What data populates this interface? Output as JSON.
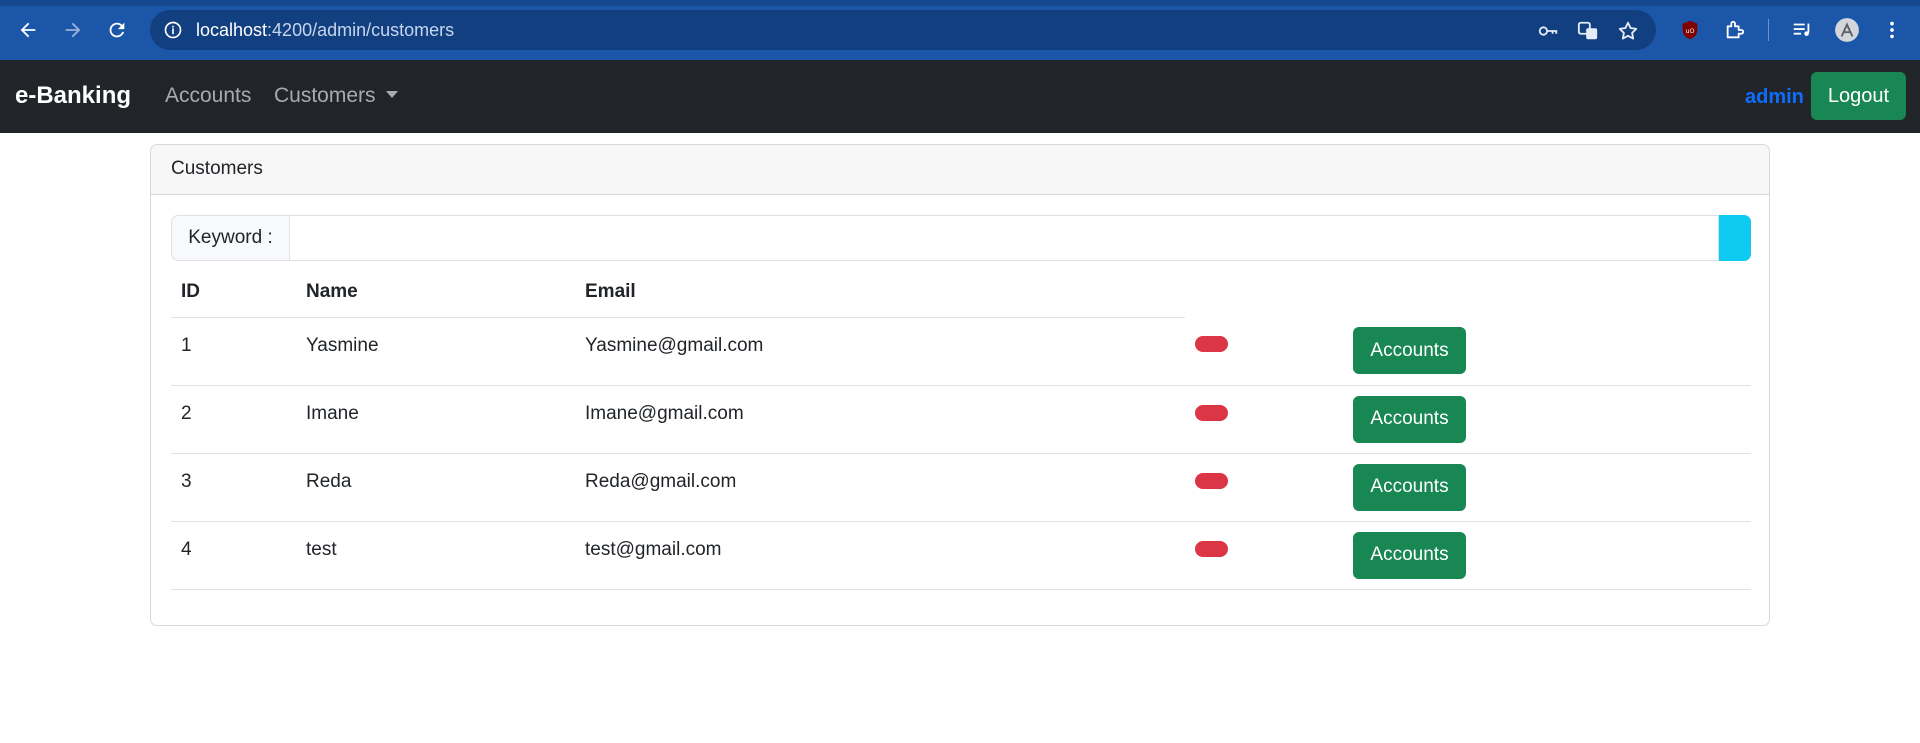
{
  "browser": {
    "url_host": "localhost",
    "url_path": ":4200/admin/customers"
  },
  "navbar": {
    "brand": "e-Banking",
    "links": [
      "Accounts",
      "Customers"
    ],
    "user": "admin",
    "logout_label": "Logout"
  },
  "card": {
    "title": "Customers",
    "search": {
      "label": "Keyword :",
      "value": "",
      "placeholder": ""
    },
    "table": {
      "headers": [
        "ID",
        "Name",
        "Email"
      ],
      "rows": [
        {
          "id": "1",
          "name": "Yasmine",
          "email": "Yasmine@gmail.com",
          "action_label": "Accounts"
        },
        {
          "id": "2",
          "name": "Imane",
          "email": "Imane@gmail.com",
          "action_label": "Accounts"
        },
        {
          "id": "3",
          "name": "Reda",
          "email": "Reda@gmail.com",
          "action_label": "Accounts"
        },
        {
          "id": "4",
          "name": "test",
          "email": "test@gmail.com",
          "action_label": "Accounts"
        }
      ]
    }
  },
  "colors": {
    "chrome": "#1b56a8",
    "navbar": "#212529",
    "primary": "#0d6efd",
    "success": "#198754",
    "danger": "#dc3545",
    "info": "#0dcaf0"
  }
}
